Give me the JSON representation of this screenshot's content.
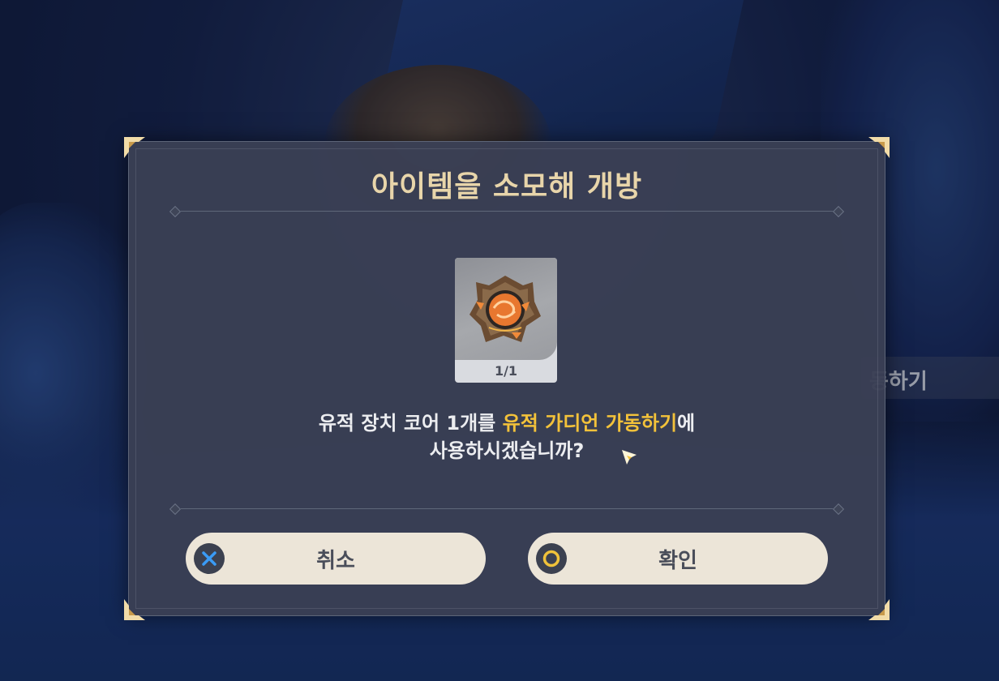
{
  "dialog": {
    "title": "아이템을 소모해 개방",
    "item": {
      "name_icon": "ruin-mechanism-core-icon",
      "count": "1/1"
    },
    "message": {
      "prefix": "유적 장치 코어 1개를 ",
      "highlight": "유적 가디언 가동하기",
      "suffix": "에",
      "line2": "사용하시겠습니까?"
    },
    "buttons": {
      "cancel": {
        "label": "취소",
        "icon": "cross-button-icon",
        "icon_color": "#3a9bf5"
      },
      "confirm": {
        "label": "확인",
        "icon": "circle-button-icon",
        "icon_color": "#f0c23a"
      }
    }
  },
  "background": {
    "side_prompt": "동하기"
  },
  "colors": {
    "title": "#e8d5aa",
    "highlight": "#f3c23a",
    "dialog_bg": "#3a4054",
    "button_bg": "#ece5d8"
  }
}
